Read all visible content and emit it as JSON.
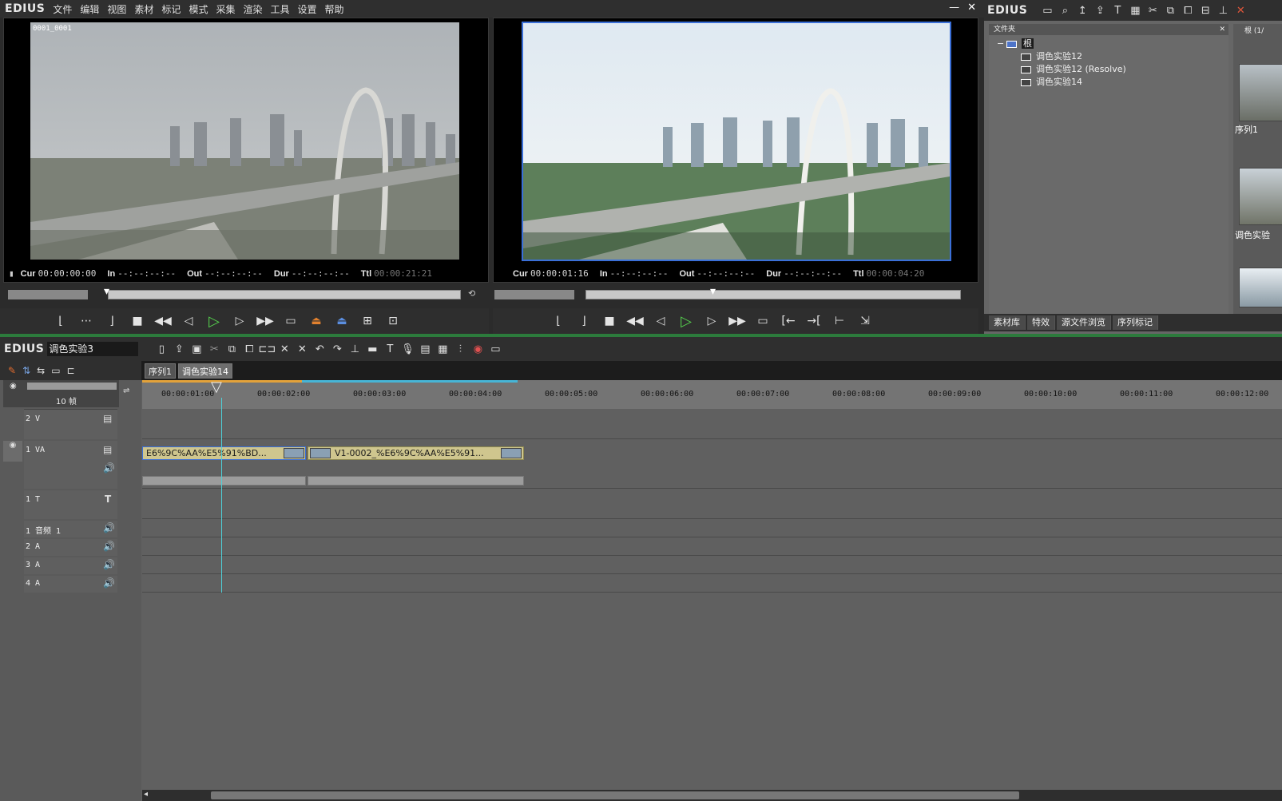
{
  "app": {
    "logo": "EDIUS",
    "menu": [
      "文件",
      "编辑",
      "视图",
      "素材",
      "标记",
      "模式",
      "采集",
      "渲染",
      "工具",
      "设置",
      "帮助"
    ],
    "window_min": "—",
    "window_close": "✕"
  },
  "player": {
    "clip_label": "0001_0001",
    "cur_label": "Cur",
    "cur": "00:00:00:00",
    "in_label": "In",
    "in": "--:--:--:--",
    "out_label": "Out",
    "out": "--:--:--:--",
    "dur_label": "Dur",
    "dur": "--:--:--:--",
    "ttl_label": "Ttl",
    "ttl": "00:00:21:21"
  },
  "recorder": {
    "cur_label": "Cur",
    "cur": "00:00:01:16",
    "in_label": "In",
    "in": "--:--:--:--",
    "out_label": "Out",
    "out": "--:--:--:--",
    "dur_label": "Dur",
    "dur": "--:--:--:--",
    "ttl_label": "Ttl",
    "ttl": "00:00:04:20"
  },
  "bin": {
    "logo": "EDIUS",
    "folder_header": "文件夹",
    "root": "根",
    "folders": [
      "调色实验12",
      "调色实验12 (Resolve)",
      "调色实验14"
    ],
    "thumb_header": "根 (1/",
    "thumbs": [
      "序列1",
      "调色实验"
    ],
    "tabs": [
      "素材库",
      "特效",
      "源文件浏览",
      "序列标记"
    ]
  },
  "timeline": {
    "logo": "EDIUS",
    "project_name": "调色实验3",
    "seq_tabs": [
      "序列1",
      "调色实验14"
    ],
    "zoom": "10 帧",
    "ruler": [
      "00:00:01:00",
      "00:00:02:00",
      "00:00:03:00",
      "00:00:04:00",
      "00:00:05:00",
      "00:00:06:00",
      "00:00:07:00",
      "00:00:08:00",
      "00:00:09:00",
      "00:00:10:00",
      "00:00:11:00",
      "00:00:12:00"
    ],
    "tracks": {
      "v2": "2 V",
      "va1": "1 VA",
      "t1": "1 T",
      "a1": "1 音频 1",
      "a2": "2 A",
      "a3": "3 A",
      "a4": "4 A"
    },
    "clips": [
      "E6%9C%AA%E5%91%BD...",
      "V1-0002_%E6%9C%AA%E5%91..."
    ]
  },
  "colors": {
    "play": "#56d24e",
    "playhead": "#4fd0d8",
    "clip": "#cfc68e",
    "record_border": "#3a6fd8"
  }
}
